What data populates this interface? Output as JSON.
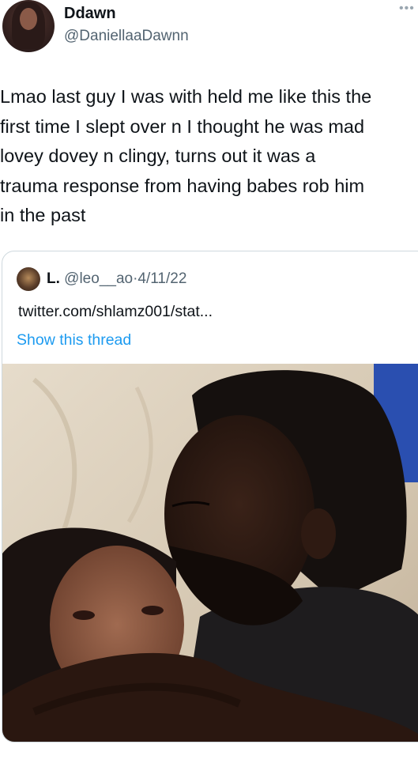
{
  "author": {
    "name": "Ddawn",
    "handle": "@DaniellaaDawnn"
  },
  "tweet": {
    "lines": [
      "Lmao last guy I was with held me like this the",
      "first time I slept over n I thought he was mad",
      "lovey dovey n clingy, turns out it was a",
      "trauma response from having babes rob him",
      "in the past"
    ]
  },
  "quoted": {
    "name": "L.",
    "handle": "@leo__ao",
    "separator": "·",
    "date": "4/11/22",
    "link_text": "twitter.com/shlamz001/stat...",
    "show_thread": "Show this thread"
  },
  "icons": {
    "more": "more-horizontal-icon"
  },
  "colors": {
    "link": "#1d9bf0",
    "secondary_text": "#536471",
    "border": "#cfd9de"
  }
}
